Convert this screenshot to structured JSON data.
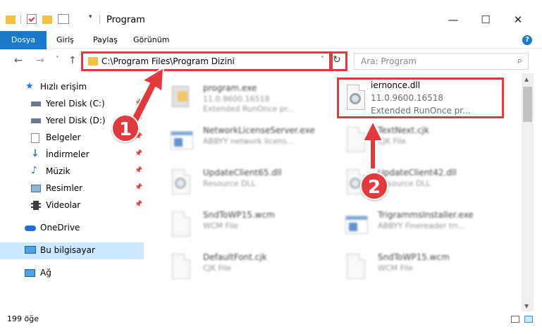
{
  "window": {
    "title": "Program",
    "minimize_glyph": "—",
    "maximize_glyph": "☐",
    "close_glyph": "✕"
  },
  "ribbon": {
    "tabs": [
      "Dosya",
      "Giriş",
      "Paylaş",
      "Görünüm"
    ],
    "help": "?"
  },
  "nav": {
    "back": "←",
    "forward": "→",
    "recent": "˅",
    "up": "↑"
  },
  "address": {
    "path": "C:\\Program Files\\Program Dizini",
    "dropdown": "˅",
    "refresh": "↻"
  },
  "search": {
    "placeholder": "Ara: Program",
    "icon": "⌕"
  },
  "sidebar": {
    "items": [
      {
        "label": "Hızlı erişim",
        "icon": "star-icon"
      },
      {
        "label": "Yerel Disk (C:)",
        "icon": "drive-icon"
      },
      {
        "label": "Yerel Disk (D:)",
        "icon": "drive-icon"
      },
      {
        "label": "Belgeler",
        "icon": "documents-icon"
      },
      {
        "label": "İndirmeler",
        "icon": "download-icon"
      },
      {
        "label": "Müzik",
        "icon": "music-icon"
      },
      {
        "label": "Resimler",
        "icon": "pictures-icon"
      },
      {
        "label": "Videolar",
        "icon": "videos-icon"
      },
      {
        "label": "OneDrive",
        "icon": "cloud-icon"
      },
      {
        "label": "Bu bilgisayar",
        "icon": "computer-icon"
      },
      {
        "label": "Ağ",
        "icon": "network-icon"
      }
    ],
    "pin": "📌"
  },
  "files": [
    {
      "name": "program.exe",
      "line1": "11.0.9600.16518",
      "line2": "Extended RunOnce pr..."
    },
    {
      "name": "iernonce.dll",
      "line1": "11.0.9600.16518",
      "line2": "Extended RunOnce pr..."
    },
    {
      "name": "NetworkLicenseServer.exe",
      "line1": "ABBYY network licens...",
      "line2": ""
    },
    {
      "name": "TextNext.cjk",
      "line1": "CJK File",
      "line2": ""
    },
    {
      "name": "UpdateClient65.dll",
      "line1": "Resource DLL",
      "line2": ""
    },
    {
      "name": "UpdateClient42.dll",
      "line1": "Resource DLL",
      "line2": ""
    },
    {
      "name": "SndToWP15.wcm",
      "line1": "WCM File",
      "line2": ""
    },
    {
      "name": "TrigrammsInstaller.exe",
      "line1": "ABBYY Finereader trr...",
      "line2": ""
    },
    {
      "name": "DefaultFont.cjk",
      "line1": "CJK File",
      "line2": ""
    },
    {
      "name": "SndToWP15.wcm",
      "line1": "WCM File",
      "line2": ""
    }
  ],
  "status": {
    "count": "199 öğe"
  },
  "annotations": {
    "step1": "1",
    "step2": "2",
    "color": "#e0393e"
  }
}
